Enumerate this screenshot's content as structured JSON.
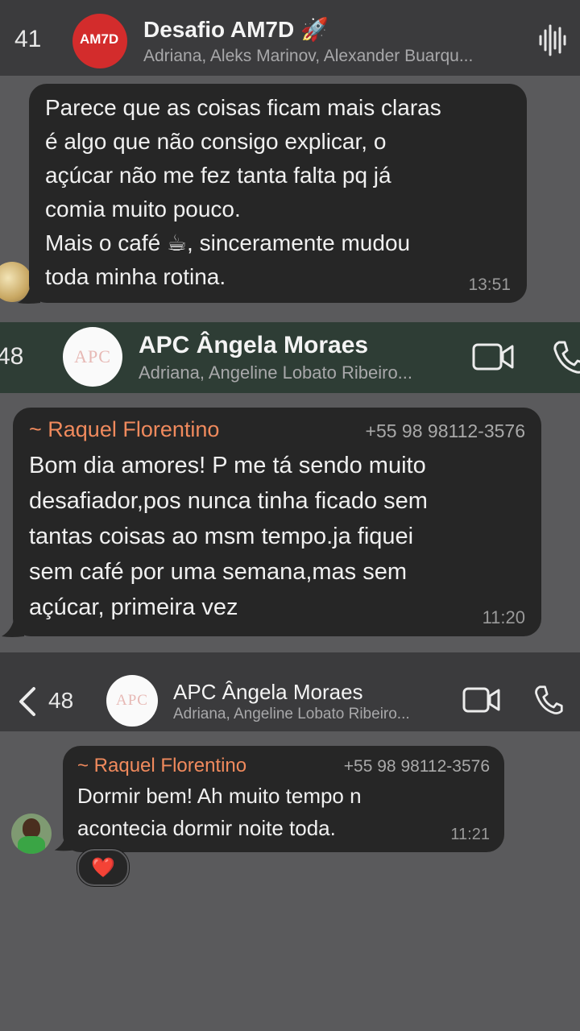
{
  "screen1": {
    "header": {
      "unread_count": "41",
      "title": "Desafio AM7D 🚀",
      "subtitle": "Adriana, Aleks Marinov, Alexander Buarqu...",
      "avatar_text": "AM7D",
      "icon": "waveform-icon"
    },
    "message": {
      "text": "Parece que as coisas ficam mais claras\né algo que não consigo explicar, o\naçúcar não me fez tanta falta pq já\ncomia muito pouco.\nMais o café ☕, sinceramente mudou\ntoda minha rotina.",
      "time": "13:51"
    }
  },
  "screen2": {
    "header": {
      "unread_count": "48",
      "title": "APC Ângela Moraes",
      "subtitle": "Adriana, Angeline Lobato Ribeiro...",
      "avatar_text": "APC",
      "icons": [
        "video-icon",
        "phone-icon"
      ]
    },
    "message": {
      "sender": "~ Raquel Florentino",
      "phone": "+55 98 98112-3576",
      "text": "Bom dia amores! P me tá sendo muito\ndesafiador,pos nunca tinha ficado sem\ntantas coisas ao msm tempo.ja fiquei\nsem café por uma semana,mas sem\naçúcar, primeira vez",
      "time": "11:20"
    }
  },
  "screen3": {
    "header": {
      "back_icon": "chevron-left-icon",
      "unread_count": "48",
      "title": "APC Ângela Moraes",
      "subtitle": "Adriana, Angeline Lobato Ribeiro...",
      "avatar_text": "APC",
      "icons": [
        "video-icon",
        "phone-icon"
      ]
    },
    "message": {
      "sender": "~ Raquel Florentino",
      "phone": "+55 98 98112-3576",
      "text": "Dormir bem! Ah muito tempo n\nacontecia dormir noite toda.",
      "time": "11:21",
      "reaction": "❤️"
    }
  },
  "colors": {
    "background": "#5a5a5c",
    "bubble": "#262626",
    "header_dark": "#3b3b3d",
    "header_green": "#2e3d35",
    "sender": "#f08a5d"
  }
}
